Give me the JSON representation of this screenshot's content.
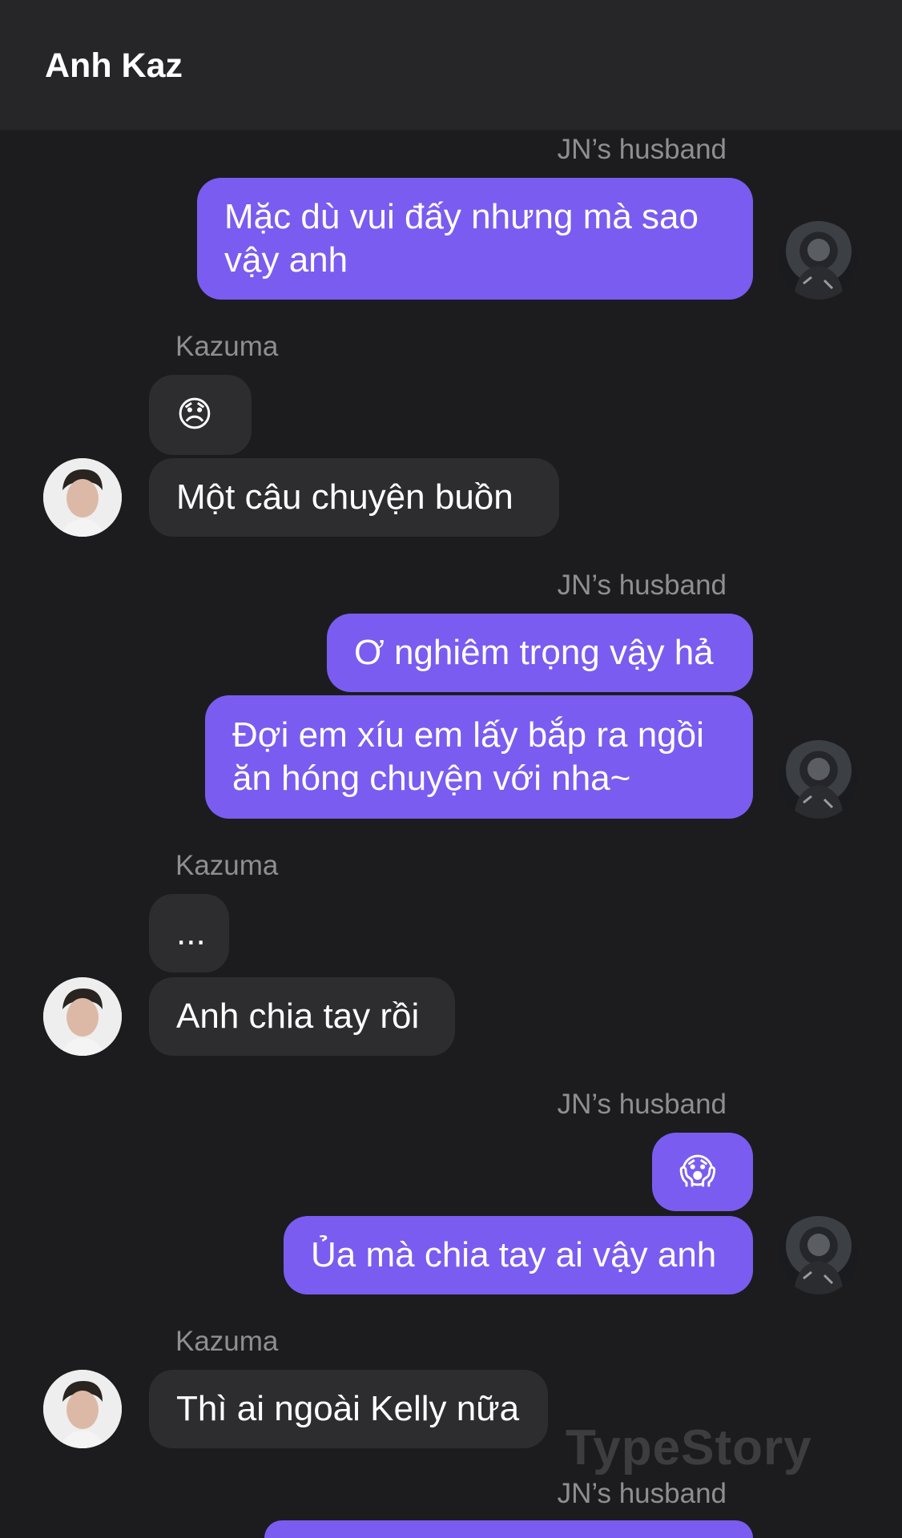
{
  "header": {
    "title": "Anh Kaz"
  },
  "senders": {
    "self": "JN’s husband",
    "other": "Kazuma"
  },
  "messages": {
    "m1": "Mặc dù vui đấy nhưng mà sao vậy anh",
    "m2": "😞",
    "m3": "Một câu chuyện buồn",
    "m4": "Ơ nghiêm trọng vậy hả",
    "m5": "Đợi em xíu em lấy bắp ra ngồi ăn hóng chuyện với nha~",
    "m6": "...",
    "m7": "Anh chia tay rồi",
    "m8": "😱",
    "m9": "Ủa mà chia tay ai vậy anh",
    "m10": "Thì ai ngoài Kelly nữa"
  },
  "watermark": "TypeStory",
  "colors": {
    "outgoing": "#7a5cf0",
    "incoming": "#2d2d30",
    "background": "#1c1c1e",
    "header": "#262628"
  }
}
